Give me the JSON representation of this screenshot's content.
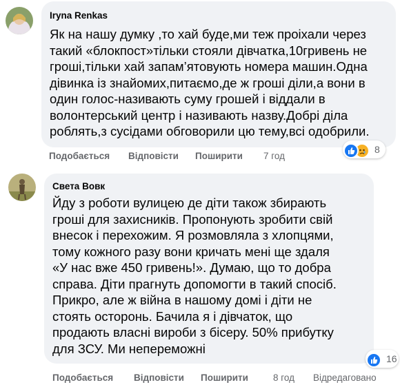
{
  "comments": [
    {
      "author": "Iryna Renkas",
      "lines": [
        "Як на нашу думку ,то хай буде,ми теж проіхали через",
        "такий «блокпост»тільки стояли дівчатка,10гривень не",
        "гроші,тільки хай запам’ятовують номера машин.Одна",
        "дівинка із знайомих,питаємо,де ж гроші діли,а вони в",
        "один голос-називають суму грошей і віддали в",
        "волонтерський центр і називають назву.Добрі діла",
        "роблять,з сусідами обговорили цю тему,всі одобрили."
      ],
      "actions": {
        "like": "Подобається",
        "reply": "Відповісти",
        "share": "Поширити",
        "time": "7 год"
      },
      "reactions": {
        "types": [
          "like-icon",
          "sad-icon"
        ],
        "count": "8",
        "colors": [
          "#1877f2",
          "#f7b125"
        ]
      }
    },
    {
      "author": "Света Вовк",
      "lines": [
        "Йду з роботи вулицею де діти також збирають",
        "гроші для захисників. Пропонують зробити свій",
        "внесок і перехожим. Я розмовляла з хлопцями,",
        "тому кожного разу вони кричать мені ще здаля",
        "«У нас вже 450 гривень!». Думаю, що то добра",
        "справа. Діти прагнуть допомогти в такий спосіб.",
        "Прикро, але ж війна в нашому домі і діти не",
        "стоять осторонь. Бачила я і дівчаток, що",
        "продають власні вироби з бісеру. 50% прибутку",
        "для ЗСУ. Ми непереможні"
      ],
      "actions": {
        "like": "Подобається",
        "reply": "Відповісти",
        "share": "Поширити",
        "time": "8 год",
        "edited": "Відредаговано"
      },
      "reactions": {
        "types": [
          "like-icon"
        ],
        "count": "16",
        "colors": [
          "#1877f2"
        ]
      }
    }
  ]
}
